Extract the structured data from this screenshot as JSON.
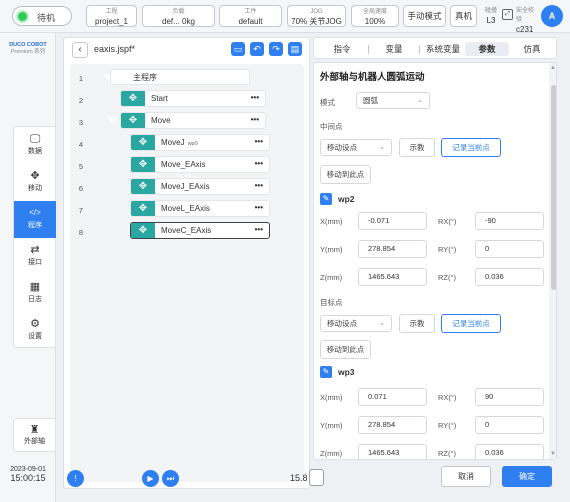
{
  "topbar": {
    "status": "待机",
    "project_label": "工程",
    "project_value": "project_1",
    "payload_label": "负载",
    "payload_value": "def... 0kg",
    "tool_label": "工件",
    "tool_value": "default",
    "jog_label": "JOG",
    "jog_value": "70% 关节JOG",
    "speed_label": "全局速度",
    "speed_value": "100%",
    "mode_button": "手动模式",
    "real_button": "真机",
    "collision_label": "碰撞",
    "collision_value": "L3",
    "safety_label": "安全校验",
    "safety_value": "c231",
    "avatar": "A"
  },
  "logo": {
    "line1": "DUCO COBOT",
    "line2": "Premium 系列"
  },
  "nav": {
    "items": [
      {
        "label": "数据",
        "icon": "monitor-icon"
      },
      {
        "label": "移动",
        "icon": "move-icon"
      },
      {
        "label": "程序",
        "icon": "code-icon"
      },
      {
        "label": "接口",
        "icon": "interface-icon"
      },
      {
        "label": "日志",
        "icon": "calendar-icon"
      },
      {
        "label": "设置",
        "icon": "gear-icon"
      }
    ],
    "external": "外部轴"
  },
  "datetime": {
    "date": "2023-09-01",
    "time": "15:00:15"
  },
  "program": {
    "filename": "eaxis.jspf*",
    "line_numbers": [
      "1",
      "2",
      "3",
      "4",
      "5",
      "6",
      "7",
      "8"
    ],
    "root": "主程序",
    "nodes": [
      {
        "label": "Start",
        "extra": ""
      },
      {
        "label": "Move",
        "extra": ""
      },
      {
        "label": "MoveJ",
        "extra": "wp0"
      },
      {
        "label": "Move_EAxis",
        "extra": ""
      },
      {
        "label": "MoveJ_EAxis",
        "extra": ""
      },
      {
        "label": "MoveL_EAxis",
        "extra": ""
      },
      {
        "label": "MoveC_EAxis",
        "extra": ""
      }
    ],
    "dots": "•••",
    "speed": "15.8"
  },
  "tabs": [
    "指令",
    "变量",
    "系统变量",
    "参数",
    "仿真"
  ],
  "active_tab": 3,
  "params": {
    "title": "外部轴与机器人圆弧运动",
    "mode_label": "模式",
    "mode_value": "圆弧",
    "mid_label": "中间点",
    "target_label": "目标点",
    "move_setting": "移动设点",
    "teach": "示教",
    "record": "记录当前点",
    "move_to": "移动到此点",
    "wp2": {
      "title": "wp2",
      "x": "-0.071",
      "y": "278.854",
      "z": "1465.643",
      "rx": "-90",
      "ry": "0",
      "rz": "0.036"
    },
    "wp3": {
      "title": "wp3",
      "x": "0.071",
      "y": "278.854",
      "z": "1465.643",
      "rx": "90",
      "ry": "0",
      "rz": "0.036"
    },
    "xl": "X(mm)",
    "yl": "Y(mm)",
    "zl": "Z(mm)",
    "rxl": "RX(°)",
    "ryl": "RY(°)",
    "rzl": "RZ(°)"
  },
  "footer": {
    "cancel": "取消",
    "ok": "确定"
  }
}
